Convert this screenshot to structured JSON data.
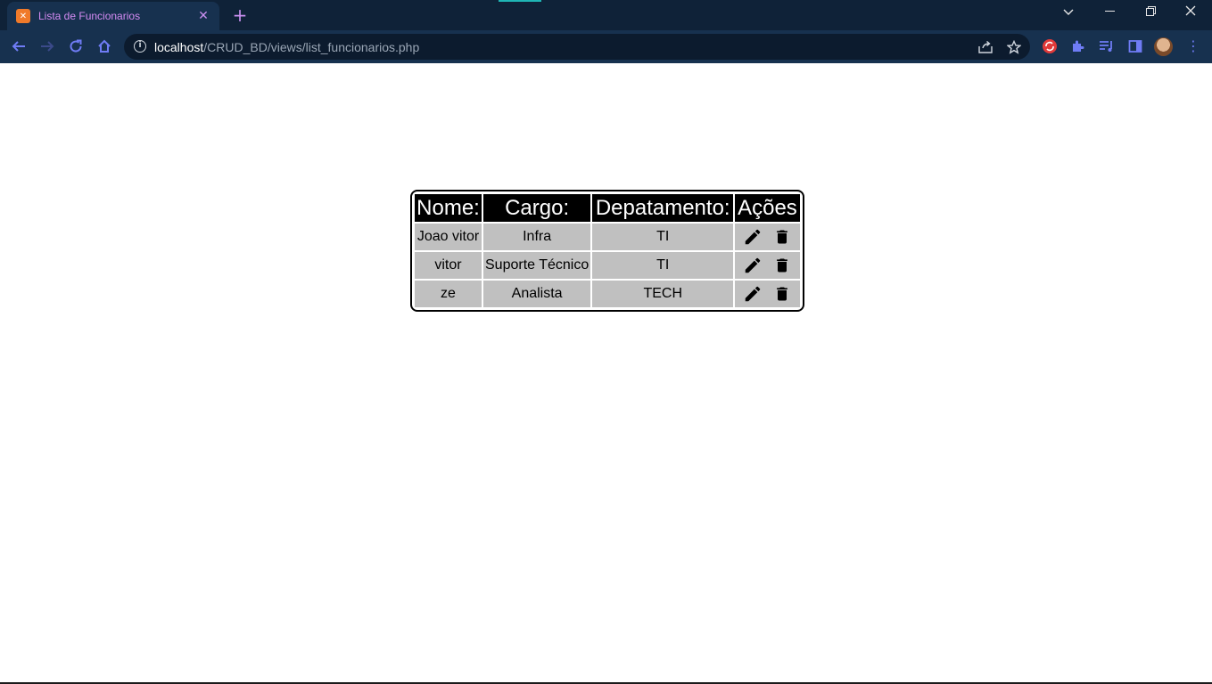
{
  "browser": {
    "tab_title": "Lista de Funcionarios",
    "tab_favicon": "xampp-icon",
    "url_host": "localhost",
    "url_path": "/CRUD_BD/views/list_funcionarios.php",
    "accent_color": "#d48bf2"
  },
  "table": {
    "headers": [
      "Nome:",
      "Cargo:",
      "Depatamento:",
      "Ações"
    ],
    "rows": [
      {
        "nome": "Joao vitor",
        "cargo": "Infra",
        "departamento": "TI"
      },
      {
        "nome": "vitor",
        "cargo": "Suporte Técnico",
        "departamento": "TI"
      },
      {
        "nome": "ze",
        "cargo": "Analista",
        "departamento": "TECH"
      }
    ],
    "action_icons": [
      "edit-pencil-icon",
      "delete-trash-icon"
    ],
    "header_bg": "#000000",
    "cell_bg": "#c0c0c0"
  }
}
